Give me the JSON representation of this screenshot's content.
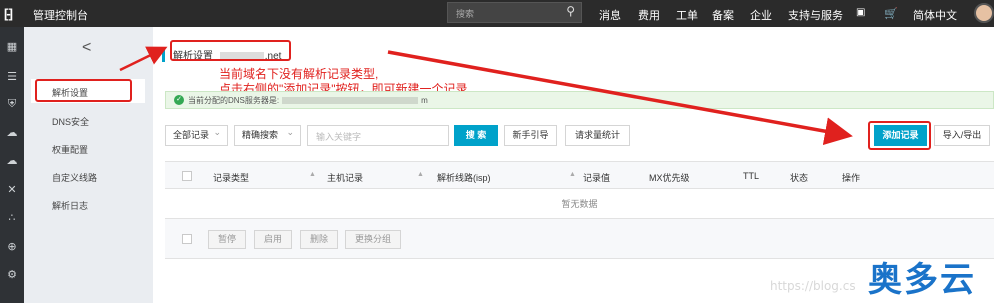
{
  "topbar": {
    "logo": "[-]",
    "console_title": "管理控制台",
    "search_placeholder": "搜索",
    "nav": [
      "消息",
      "费用",
      "工单",
      "备案",
      "企业",
      "支持与服务",
      "简体中文"
    ]
  },
  "sidenav": {
    "collapse_glyph": "<",
    "items": [
      "解析设置",
      "DNS安全",
      "权重配置",
      "自定义线路",
      "解析日志"
    ]
  },
  "breadcrumb": {
    "label": "解析设置",
    "domain": ".net"
  },
  "annotation": {
    "line1": "当前域名下没有解析记录类型,",
    "line2": "点击右侧的\"添加记录\"按钮，即可新建一个记录"
  },
  "notice": {
    "text": "当前分配的DNS服务器是:",
    "tail": "m"
  },
  "toolbar": {
    "filter_all": "全部记录",
    "search_mode": "精确搜索",
    "keyword_placeholder": "输入关键字",
    "search_btn": "搜 索",
    "guide_btn": "新手引导",
    "stats_btn": "请求量统计",
    "add_btn": "添加记录",
    "import_btn": "导入/导出"
  },
  "table": {
    "columns": [
      "记录类型",
      "主机记录",
      "解析线路(isp)",
      "记录值",
      "MX优先级",
      "TTL",
      "状态",
      "操作"
    ],
    "empty_text": "暂无数据",
    "batch_buttons": [
      "暂停",
      "启用",
      "删除",
      "更换分组"
    ]
  },
  "watermark": "https://blog.cs",
  "brand": "奥多云",
  "colors": {
    "accent": "#00a2ca",
    "annotation": "#e0211e",
    "brand": "#1a73c9"
  }
}
